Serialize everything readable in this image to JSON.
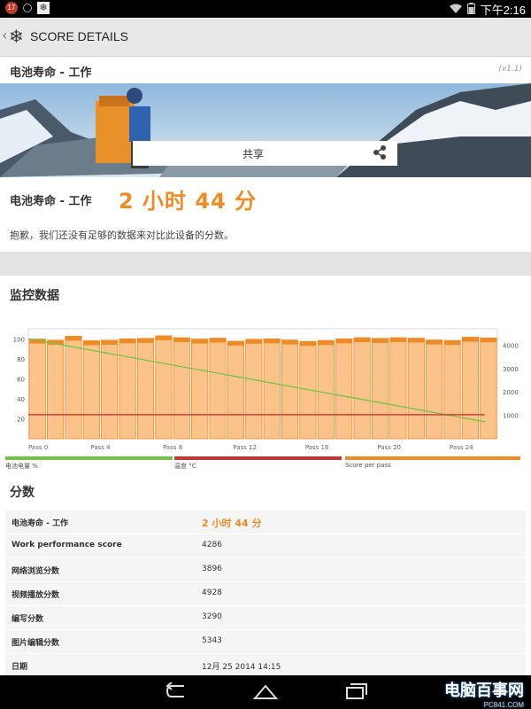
{
  "status_bar": {
    "notification_count": "17",
    "time": "下午2:16"
  },
  "action_bar": {
    "title": "SCORE DETAILS"
  },
  "header": {
    "title": "电池寿命 - 工作",
    "version": "(v1.1)"
  },
  "share": {
    "label": "共享"
  },
  "result": {
    "label": "电池寿命 - 工作",
    "value": "2 小时 44 分"
  },
  "notice": "抱歉，我们还没有足够的数据来对比此设备的分数。",
  "monitor": {
    "title": "监控数据"
  },
  "chart_data": {
    "type": "bar",
    "categories": [
      "Pass 0",
      "Pass 4",
      "Pass 8",
      "Pass 12",
      "Pass 16",
      "Pass 20",
      "Pass 24"
    ],
    "left_axis": {
      "ticks": [
        20,
        40,
        60,
        80,
        100
      ],
      "ylim": [
        0,
        110
      ]
    },
    "right_axis": {
      "ticks": [
        1000,
        2000,
        3000,
        4000
      ],
      "ylim": [
        0,
        4700
      ]
    },
    "series": [
      {
        "name": "Score per pass",
        "color": "#f08a24",
        "values": [
          4260,
          4210,
          4380,
          4190,
          4210,
          4270,
          4290,
          4400,
          4320,
          4260,
          4300,
          4170,
          4250,
          4270,
          4220,
          4160,
          4200,
          4270,
          4320,
          4290,
          4320,
          4300,
          4220,
          4200,
          4340,
          4310
        ]
      },
      {
        "name": "电池电量 %",
        "color": "#6cc644",
        "start": 100,
        "end": 17
      },
      {
        "name": "温度 °C",
        "color": "#cc3333",
        "value": 24
      }
    ],
    "legend": [
      "电池电量 %",
      "温度 °C",
      "Score per pass"
    ]
  },
  "scores": {
    "title": "分数",
    "rows": [
      {
        "label": "电池寿命 - 工作",
        "value": "2 小时 44 分"
      },
      {
        "label": "Work performance score",
        "value": "4286"
      },
      {
        "label": "网络浏览分数",
        "value": "3896"
      },
      {
        "label": "视频播放分数",
        "value": "4928"
      },
      {
        "label": "编写分数",
        "value": "3290"
      },
      {
        "label": "图片编辑分数",
        "value": "5343"
      },
      {
        "label": "日期",
        "value": "12月 25 2014 14:15"
      }
    ]
  },
  "watermark": {
    "title": "电脑百事网",
    "url": "PC841.COM"
  }
}
